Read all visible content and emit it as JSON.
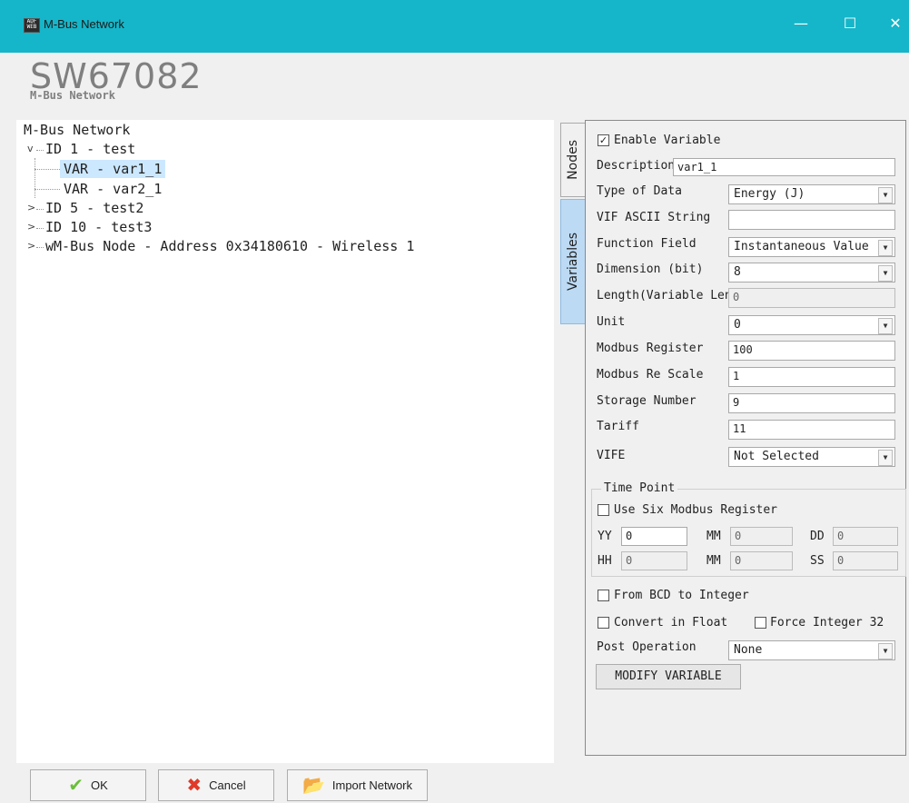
{
  "window": {
    "title": "M-Bus Network",
    "icon_text": "ADF WEB",
    "minimize": "—",
    "maximize": "☐",
    "close": "✕"
  },
  "header": {
    "title": "SW67082",
    "subtitle": "M-Bus Network"
  },
  "tree": {
    "root": "M-Bus Network",
    "nodes": [
      {
        "label": "ID 1 - test",
        "expanded": true
      },
      {
        "label": "VAR - var1_1",
        "selected": true
      },
      {
        "label": "VAR - var2_1"
      },
      {
        "label": "ID 5 - test2",
        "expanded": false
      },
      {
        "label": "ID 10 - test3",
        "expanded": false
      },
      {
        "label": "wM-Bus Node - Address 0x34180610 - Wireless 1",
        "expanded": false
      }
    ],
    "expanded_glyph": "v",
    "collapsed_glyph": ">"
  },
  "tabs": {
    "nodes": "Nodes",
    "variables": "Variables"
  },
  "form": {
    "enable_variable": {
      "label": "Enable Variable",
      "checked": true
    },
    "description": {
      "label": "Description",
      "value": "var1_1"
    },
    "type_of_data": {
      "label": "Type of Data",
      "value": "Energy (J)"
    },
    "vif_ascii": {
      "label": "VIF ASCII String",
      "value": ""
    },
    "function_field": {
      "label": "Function Field",
      "value": "Instantaneous Value"
    },
    "dimension": {
      "label": "Dimension (bit)",
      "value": "8"
    },
    "length": {
      "label": "Length(Variable Len)",
      "value": "0"
    },
    "unit": {
      "label": "Unit",
      "value": "0"
    },
    "modbus_register": {
      "label": "Modbus Register",
      "value": "100"
    },
    "modbus_rescale": {
      "label": "Modbus Re Scale",
      "value": "1"
    },
    "storage_number": {
      "label": "Storage Number",
      "value": "9"
    },
    "tariff": {
      "label": "Tariff",
      "value": "11"
    },
    "vife": {
      "label": "VIFE",
      "value": "Not Selected"
    },
    "time_point": {
      "legend": "Time Point",
      "use_six": {
        "label": "Use Six Modbus Register",
        "checked": false
      },
      "yy": {
        "label": "YY",
        "value": "0"
      },
      "mm1": {
        "label": "MM",
        "value": "0"
      },
      "dd": {
        "label": "DD",
        "value": "0"
      },
      "hh": {
        "label": "HH",
        "value": "0"
      },
      "mm2": {
        "label": "MM",
        "value": "0"
      },
      "ss": {
        "label": "SS",
        "value": "0"
      }
    },
    "bcd_to_int": {
      "label": "From BCD to Integer",
      "checked": false
    },
    "convert_float": {
      "label": "Convert in Float",
      "checked": false
    },
    "force_int32": {
      "label": "Force Integer 32",
      "checked": false
    },
    "post_operation": {
      "label": "Post Operation",
      "value": "None"
    },
    "modify_button": "MODIFY VARIABLE",
    "check_glyph": "✓",
    "arrow_glyph": "▼"
  },
  "footer": {
    "ok": "OK",
    "ok_icon": "✔",
    "cancel": "Cancel",
    "cancel_icon": "✖",
    "import": "Import Network",
    "import_icon": "📂"
  },
  "colors": {
    "titlebar": "#15b6c9",
    "selected": "#cce8ff",
    "ok_icon": "#6abf3b",
    "cancel_icon": "#e03a2a",
    "import_icon": "#e8b830"
  }
}
